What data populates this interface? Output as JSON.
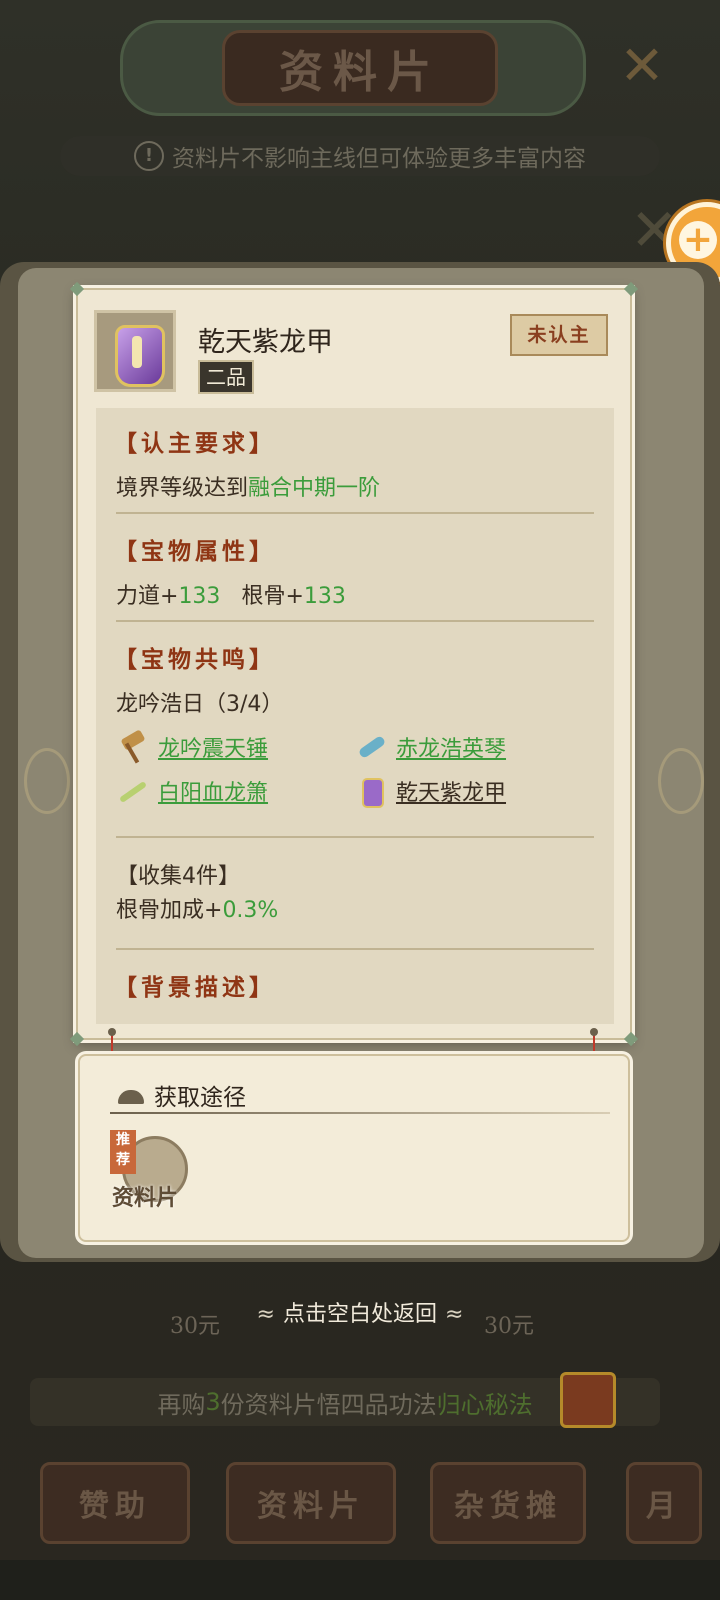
{
  "background": {
    "title": "资料片",
    "notice": "资料片不影响主线但可体验更多丰富内容",
    "prices": [
      "30元",
      "30元"
    ],
    "promo": {
      "prefix": "再购",
      "count": "3",
      "middle": "份资料片悟四品功法",
      "highlight": "归心秘法"
    },
    "tabs": [
      "赞助",
      "资料片",
      "杂货摊",
      "月"
    ]
  },
  "item": {
    "name": "乾天紫龙甲",
    "grade": "二品",
    "status": "未认主"
  },
  "sections": {
    "requirement": {
      "title": "【认主要求】",
      "text": "境界等级达到",
      "value": "融合中期一阶"
    },
    "attributes": {
      "title": "【宝物属性】",
      "stats": [
        {
          "label": "力道+",
          "value": "133"
        },
        {
          "label": "根骨+",
          "value": "133"
        }
      ]
    },
    "resonance": {
      "title": "【宝物共鸣】",
      "set_name": "龙吟浩日（3/4）",
      "items": [
        {
          "name": "龙吟震天锤",
          "icon": "hammer-icon"
        },
        {
          "name": "赤龙浩英琴",
          "icon": "zither-icon"
        },
        {
          "name": "白阳血龙箫",
          "icon": "flute-icon"
        },
        {
          "name": "乾天紫龙甲",
          "icon": "armor-icon"
        }
      ]
    },
    "collection": {
      "title": "【收集4件】",
      "label": "根骨加成+",
      "value": "0.3%"
    },
    "background_desc": {
      "title": "【背景描述】"
    }
  },
  "source": {
    "title": "获取途径",
    "tag": "推荐",
    "label": "资料片"
  },
  "footer": {
    "back_hint": "点击空白处返回"
  },
  "colors": {
    "accent_green": "#3b9c3b",
    "section_red": "#8f3514",
    "panel_bg": "#efe7d3"
  }
}
